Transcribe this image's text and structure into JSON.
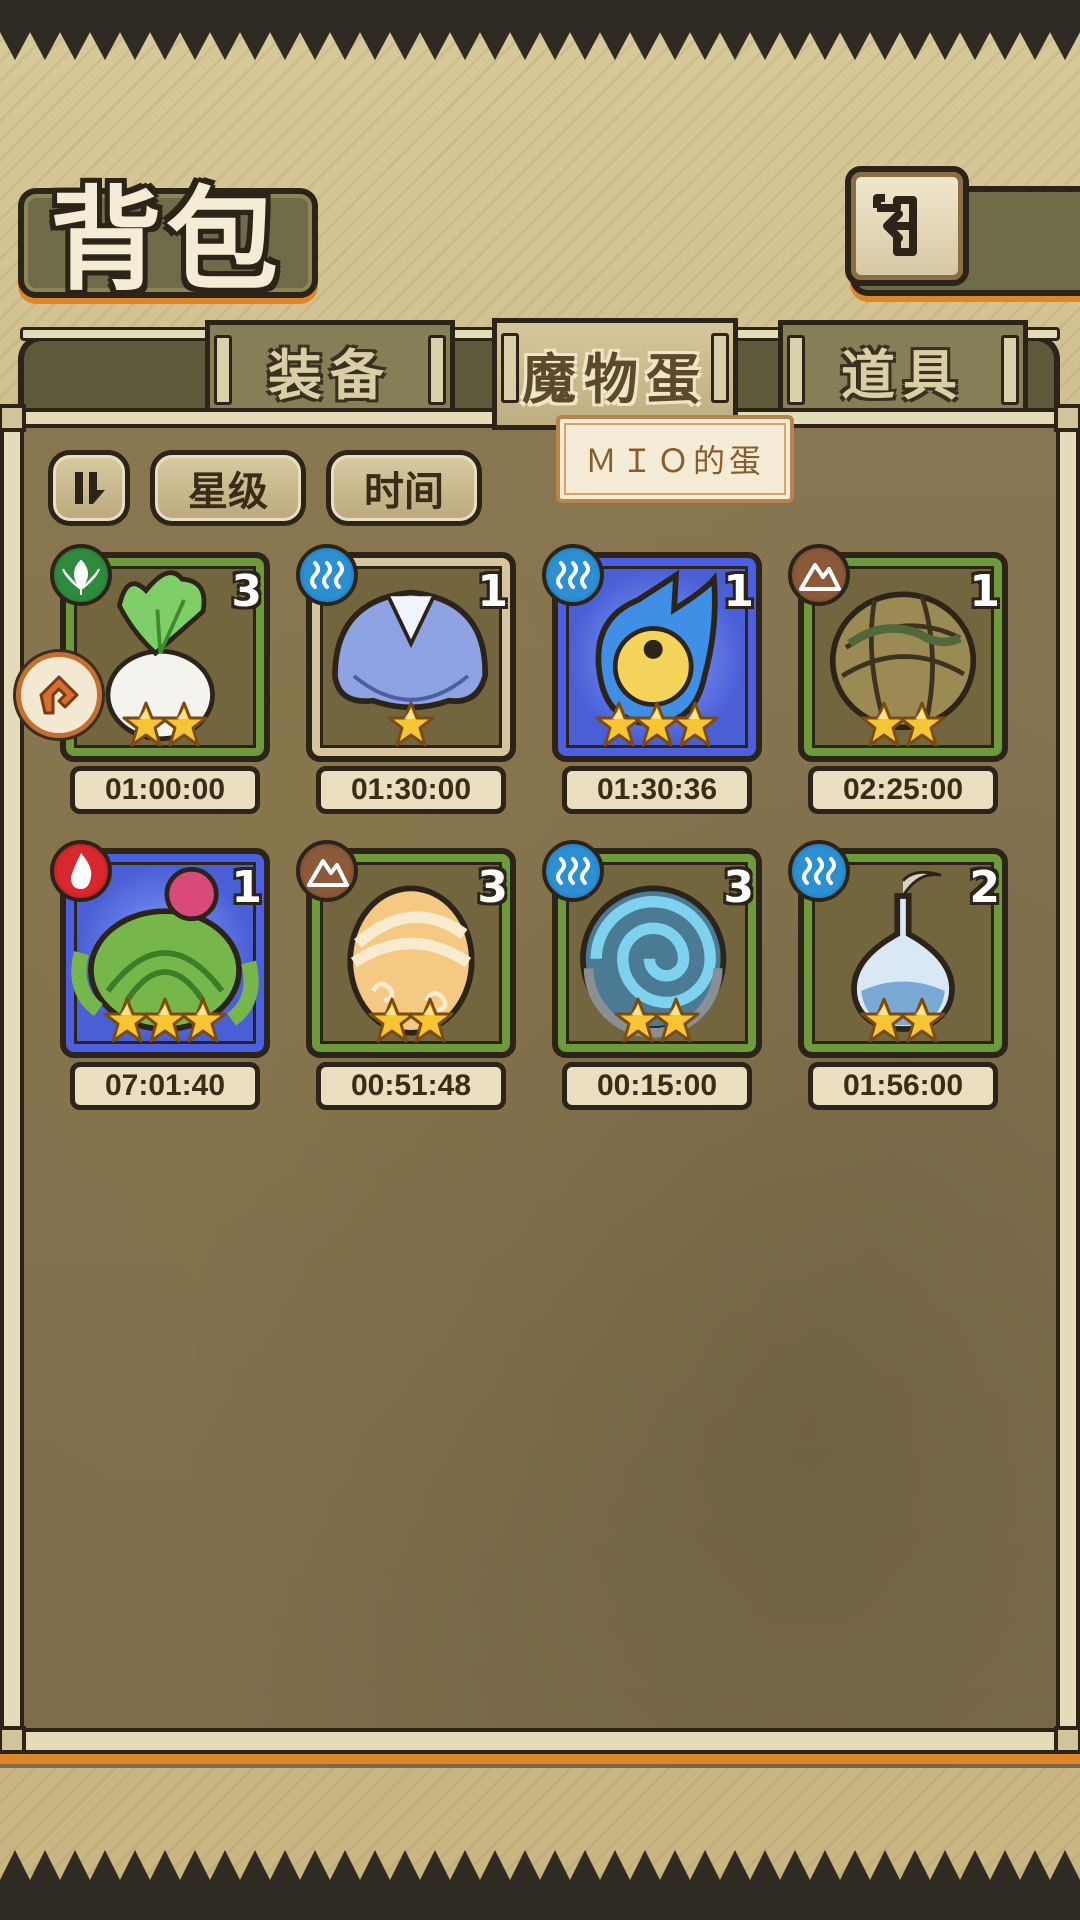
{
  "header": {
    "title": "背包",
    "back_icon": "return-arrow-icon"
  },
  "tabs": [
    {
      "label": "装备",
      "active": false
    },
    {
      "label": "魔物蛋",
      "active": true
    },
    {
      "label": "道具",
      "active": false
    }
  ],
  "toolbar": {
    "sort_order_icon": "sort-order-icon",
    "star_label": "星级",
    "time_label": "时间"
  },
  "tooltip": {
    "text": "ＭＩＯ的蛋"
  },
  "eggs": [
    {
      "element": "nature",
      "count": "3",
      "stars": 2,
      "timer": "01:00:00",
      "frame": "green",
      "art": "turnip"
    },
    {
      "element": "water",
      "count": "1",
      "stars": 1,
      "timer": "01:30:00",
      "frame": "beige",
      "art": "blue-hood"
    },
    {
      "element": "water",
      "count": "1",
      "stars": 3,
      "timer": "01:30:36",
      "frame": "blue",
      "art": "eye-drop"
    },
    {
      "element": "earth",
      "count": "1",
      "stars": 2,
      "timer": "02:25:00",
      "frame": "green",
      "art": "vine-egg"
    },
    {
      "element": "fire",
      "count": "1",
      "stars": 3,
      "timer": "07:01:40",
      "frame": "blue",
      "art": "cactus"
    },
    {
      "element": "earth",
      "count": "3",
      "stars": 2,
      "timer": "00:51:48",
      "frame": "green",
      "art": "swirl-egg"
    },
    {
      "element": "water",
      "count": "3",
      "stars": 2,
      "timer": "00:15:00",
      "frame": "green",
      "art": "shell"
    },
    {
      "element": "water",
      "count": "2",
      "stars": 2,
      "timer": "01:56:00",
      "frame": "green",
      "art": "flask"
    }
  ],
  "colors": {
    "frame_dark": "#2d2419",
    "accent_orange": "#e0862a",
    "nature": "#2e8b3e",
    "water": "#2b8fd2",
    "earth": "#8c5a3b",
    "fire": "#d8282d"
  }
}
